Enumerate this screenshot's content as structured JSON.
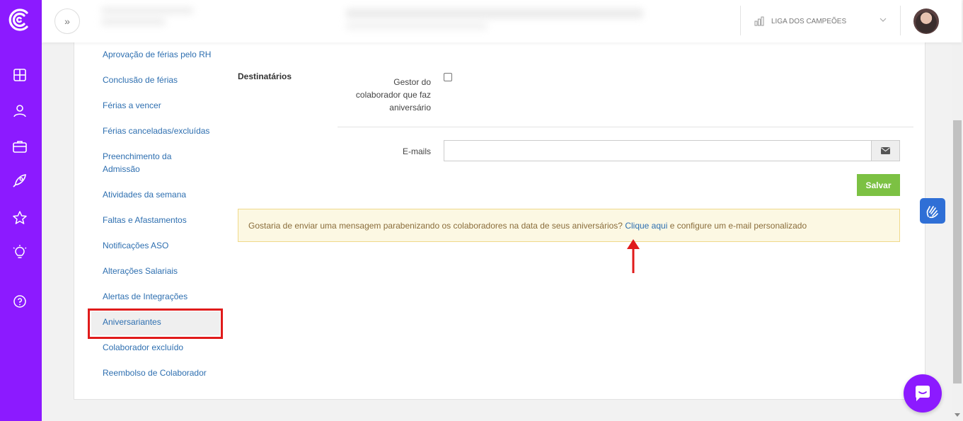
{
  "colors": {
    "rail": "#8c1aff",
    "link": "#2e6fb0",
    "save_button": "#7cc143",
    "alert_bg": "#fcf8e3",
    "alert_text": "#8a6d3b",
    "highlight": "#e01b1b",
    "accessibility": "#2f6fd6"
  },
  "rail": {
    "icons": [
      "logo-icon",
      "dashboard-icon",
      "user-icon",
      "briefcase-icon",
      "rocket-icon",
      "star-icon",
      "lightbulb-icon",
      "help-icon"
    ]
  },
  "topbar": {
    "expand_label": "»",
    "company_name": "LIGA DOS CAMPEÕES"
  },
  "menu": {
    "items": [
      "Aprovação de férias pelo RH",
      "Conclusão de férias",
      "Férias a vencer",
      "Férias canceladas/excluídas",
      "Preenchimento da Admissão",
      "Atividades da semana",
      "Faltas e Afastamentos",
      "Notificações ASO",
      "Alterações Salariais",
      "Alertas de Integrações",
      "Aniversariantes",
      "Colaborador excluído",
      "Reembolso de Colaborador"
    ],
    "active": "Aniversariantes"
  },
  "form": {
    "section_label": "Destinatários",
    "manager_label": "Gestor do colaborador que faz aniversário",
    "manager_checked": false,
    "emails_label": "E-mails",
    "emails_value": "",
    "save_label": "Salvar"
  },
  "alert": {
    "text_before": "Gostaria de enviar uma mensagem parabenizando os colaboradores na data de seus aniversários? ",
    "link_text": "Clique aqui",
    "text_after": " e configure um e-mail personalizado"
  }
}
